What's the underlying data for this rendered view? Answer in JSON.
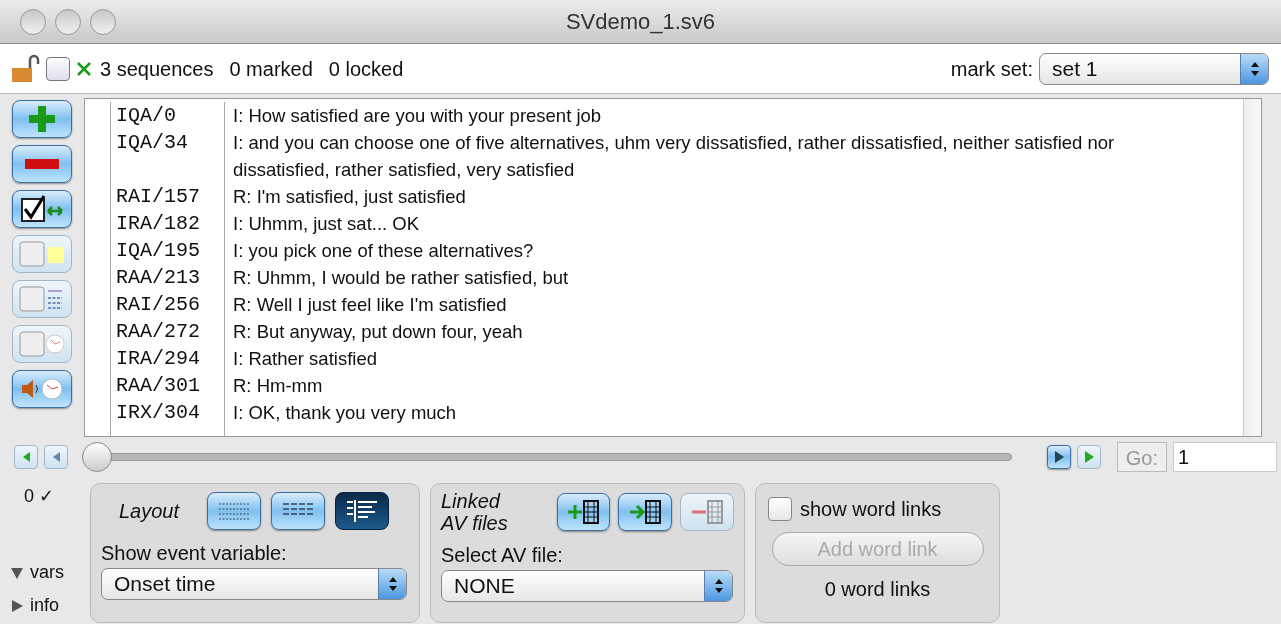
{
  "window": {
    "title": "SVdemo_1.sv6"
  },
  "toolbar": {
    "select_all_checked": false,
    "sequences": "3 sequences",
    "marked": "0 marked",
    "locked": "0 locked",
    "mark_set_label": "mark set:",
    "mark_set_value": "set 1"
  },
  "side_buttons": [
    {
      "kind": "add",
      "disabled": false
    },
    {
      "kind": "remove",
      "disabled": false
    },
    {
      "kind": "check",
      "disabled": false
    },
    {
      "kind": "note",
      "disabled": true
    },
    {
      "kind": "def",
      "disabled": true
    },
    {
      "kind": "clock",
      "disabled": true
    },
    {
      "kind": "sound",
      "disabled": false
    }
  ],
  "transcript": [
    {
      "code": "IQA/0",
      "text": "I: How satisfied are you with your present job"
    },
    {
      "code": "IQA/34",
      "text": "I: and you can choose one of five alternatives, uhm very dissatisfied, rather dissatisfied, neither satisfied nor dissatisfied, rather satisfied, very satisfied"
    },
    {
      "code": "RAI/157",
      "text": "R: I'm satisfied, just satisfied"
    },
    {
      "code": "IRA/182",
      "text": "I: Uhmm, just sat... OK"
    },
    {
      "code": "IQA/195",
      "text": "I: you pick one of these alternatives?"
    },
    {
      "code": "RAA/213",
      "text": "R: Uhmm, I would be rather satisfied, but"
    },
    {
      "code": "RAI/256",
      "text": "R: Well I just feel like I'm satisfied"
    },
    {
      "code": "RAA/272",
      "text": "R: But anyway, put down four, yeah"
    },
    {
      "code": "IRA/294",
      "text": "I: Rather satisfied"
    },
    {
      "code": "RAA/301",
      "text": "R: Hm-mm"
    },
    {
      "code": "IRX/304",
      "text": "I: OK, thank you very much"
    }
  ],
  "navigator": {
    "level": 0,
    "go_label": "Go:",
    "go_value": "1"
  },
  "count": "0 ✓",
  "disclosures": [
    {
      "label": "vars",
      "expanded": true
    },
    {
      "label": "info",
      "expanded": false
    }
  ],
  "layout_panel": {
    "title": "Layout",
    "buttons": [
      {
        "kind": "grid",
        "selected": false
      },
      {
        "kind": "rows",
        "selected": false
      },
      {
        "kind": "outline",
        "selected": true
      }
    ],
    "variable_label": "Show event variable:",
    "variable_value": "Onset time"
  },
  "av_panel": {
    "title": "Linked\nAV files",
    "buttons": [
      {
        "kind": "add",
        "disabled": false
      },
      {
        "kind": "link",
        "disabled": false
      },
      {
        "kind": "remove",
        "disabled": true
      }
    ],
    "select_label": "Select AV file:",
    "select_value": "NONE"
  },
  "word_links": {
    "show_label": "show word links",
    "checked": false,
    "add_label": "Add word link",
    "add_disabled": true,
    "count": "0 word links"
  }
}
